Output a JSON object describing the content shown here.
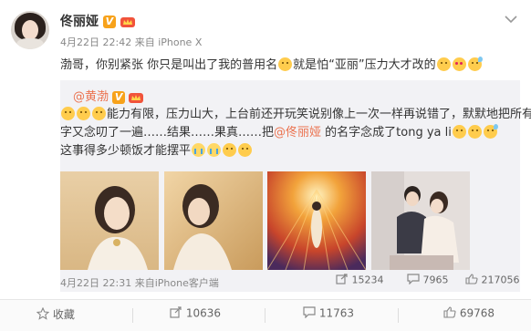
{
  "post": {
    "author": "佟丽娅",
    "verified_badge": "V",
    "meta_time": "4月22日 22:42",
    "meta_source": "来自 iPhone X",
    "text_prefix": "渤哥，你别紧张 你只是叫出了我的普用名",
    "text_mid": "就是怕“亚丽”压力大才改的"
  },
  "repost": {
    "author": "@黄渤",
    "text_line1": "能力有限，压力山大，上台前还开玩笑说别像上一次一样再说错了，默默地把所有名",
    "text_line2a": "字又念叨了一遍……结果……果真……把",
    "mention": "@佟丽娅",
    "text_line2b": " 的名字念成了tong ya li",
    "text_line3": "这事得多少顿饭才能摆平",
    "meta_time": "4月22日 22:31",
    "meta_source": "来自iPhone客户端",
    "stats": {
      "reposts": "15234",
      "comments": "7965",
      "likes": "217056"
    }
  },
  "actions": {
    "favorite": "收藏",
    "repost": "10636",
    "comment": "11763",
    "like": "69768"
  },
  "icons": [
    "crown-icon",
    "chevron-down-icon",
    "share-icon",
    "comment-icon",
    "thumbs-up-icon",
    "star-icon"
  ]
}
